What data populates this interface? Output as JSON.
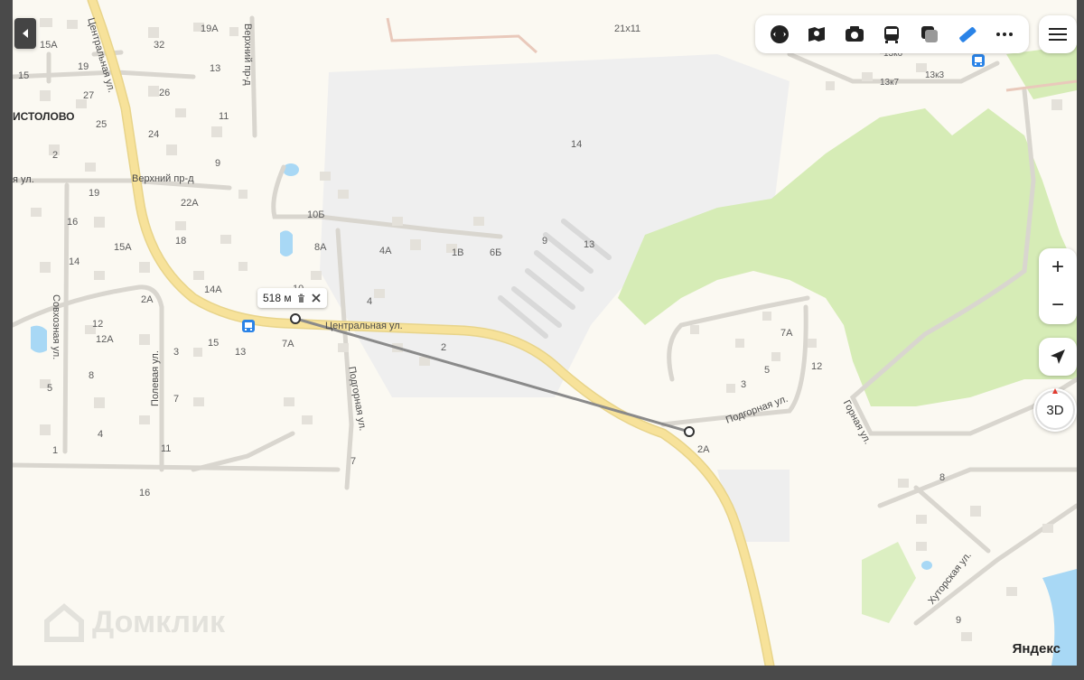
{
  "map": {
    "place_name": "ИСТОЛОВО",
    "streets": {
      "tsentralnaya_top": "Центральная ул.",
      "tsentralnaya_mid": "Центральная ул.",
      "verkhniy_ul": "я ул.",
      "verkhniy_proezd_vert": "Верхний пр-д",
      "verkhniy_proezd": "Верхний пр-д",
      "sovkhoznaya": "Совхозная ул.",
      "polevaya": "Полевая ул.",
      "podgornaya_left": "Подгорная ул.",
      "podgornaya_right": "Подгорная ул.",
      "gornaya": "Горная ул.",
      "khutorskaya": "Хуторская ул."
    },
    "house_numbers": [
      "15А",
      "32",
      "19А",
      "15",
      "19",
      "13",
      "27",
      "26",
      "25",
      "11",
      "24",
      "2",
      "9",
      "19",
      "22А",
      "16",
      "18",
      "15А",
      "14",
      "2А",
      "14А",
      "12",
      "10",
      "12А",
      "3",
      "15",
      "13",
      "7А",
      "8",
      "7",
      "5",
      "4",
      "11",
      "1",
      "16",
      "7",
      "10Б",
      "8А",
      "4А",
      "1В",
      "6Б",
      "9",
      "13",
      "4",
      "2",
      "14",
      "21х11",
      "13к6",
      "13к7",
      "13к3",
      "7А",
      "5",
      "3",
      "12",
      "2А",
      "8",
      "9"
    ]
  },
  "measure": {
    "distance": "518 м",
    "delete_icon": "trash-icon",
    "close_icon": "close-icon"
  },
  "toolbar": {
    "icons": [
      "layers-icon",
      "panorama-icon",
      "camera-icon",
      "transport-icon",
      "traffic-icon",
      "ruler-icon",
      "more-icon"
    ]
  },
  "controls": {
    "menu_icon": "menu-icon",
    "back_icon": "back-arrow-icon",
    "zoom_in": "+",
    "zoom_out": "−",
    "locate_icon": "locate-icon",
    "view_3d": "3D"
  },
  "watermark": "Домклик",
  "brand": "Яндекс",
  "colors": {
    "map_bg": "#fbf9f2",
    "road_main": "#f7e29a",
    "forest": "#d6ecb6",
    "industrial": "#efefef",
    "water": "#a8d8f5",
    "bus_stop": "#2a83e7"
  }
}
